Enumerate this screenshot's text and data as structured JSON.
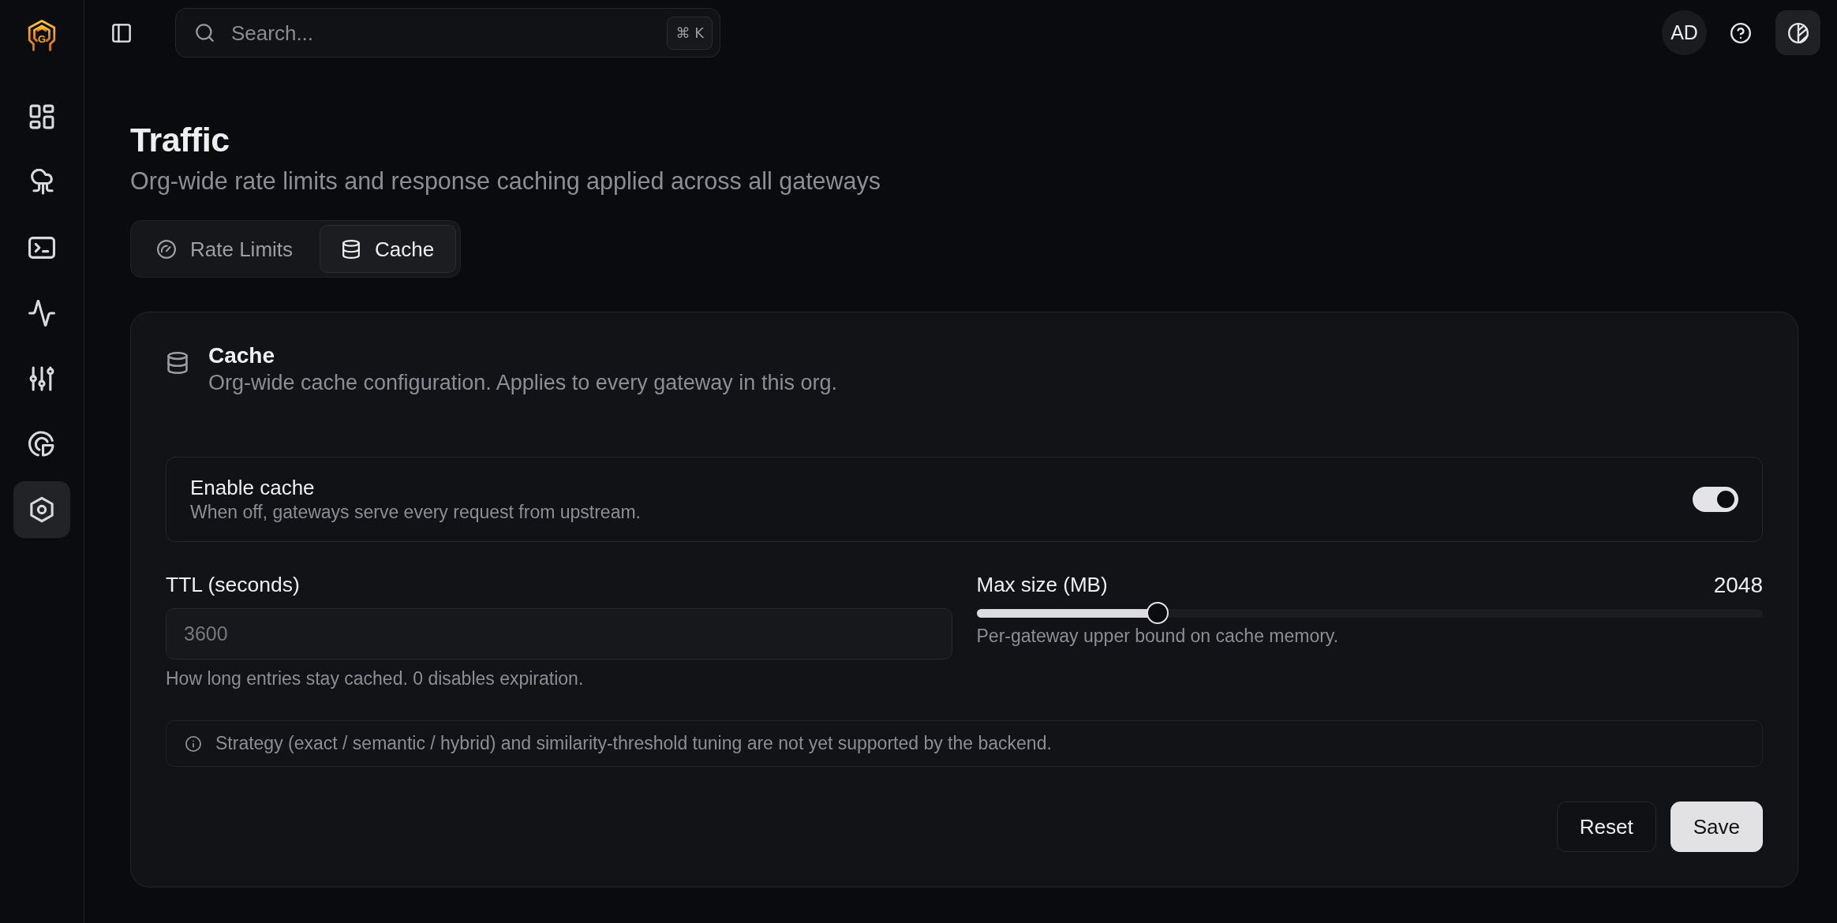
{
  "brand": {
    "letter": "G"
  },
  "sidebar": {
    "items": [
      {
        "selected": false
      },
      {
        "selected": false
      },
      {
        "selected": false
      },
      {
        "selected": false
      },
      {
        "selected": false
      },
      {
        "selected": false
      },
      {
        "selected": true
      }
    ]
  },
  "topbar": {
    "search": {
      "placeholder": "Search...",
      "shortcut": "⌘ K"
    },
    "avatar": {
      "initials": "AD"
    }
  },
  "header": {
    "title": "Traffic",
    "subtitle": "Org-wide rate limits and response caching applied across all gateways"
  },
  "tabs": [
    {
      "label": "Rate Limits",
      "selected": false
    },
    {
      "label": "Cache",
      "selected": true
    }
  ],
  "card": {
    "title": "Cache",
    "description": "Org-wide cache configuration. Applies to every gateway in this org.",
    "enable": {
      "label": "Enable cache",
      "description": "When off, gateways serve every request from upstream.",
      "on": true
    },
    "ttl": {
      "label": "TTL (seconds)",
      "placeholder": "3600",
      "hint": "How long entries stay cached. 0 disables expiration."
    },
    "max_size": {
      "label": "Max size (MB)",
      "value": "2048",
      "level": 0.23,
      "hint": "Per-gateway upper bound on cache memory."
    },
    "note": "Strategy (exact / semantic / hybrid) and similarity-threshold tuning are not yet supported by the backend.",
    "buttons": [
      {
        "label": "Reset",
        "kind": "outline"
      },
      {
        "label": "Save",
        "kind": "primary"
      }
    ]
  }
}
